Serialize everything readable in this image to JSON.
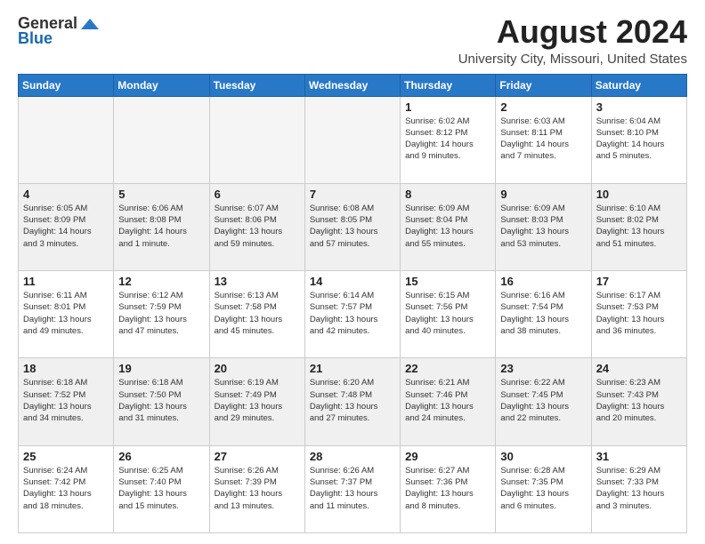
{
  "logo": {
    "general": "General",
    "blue": "Blue"
  },
  "title": {
    "month_year": "August 2024",
    "location": "University City, Missouri, United States"
  },
  "days_of_week": [
    "Sunday",
    "Monday",
    "Tuesday",
    "Wednesday",
    "Thursday",
    "Friday",
    "Saturday"
  ],
  "weeks": [
    {
      "shaded": false,
      "days": [
        {
          "date": "",
          "info": ""
        },
        {
          "date": "",
          "info": ""
        },
        {
          "date": "",
          "info": ""
        },
        {
          "date": "",
          "info": ""
        },
        {
          "date": "1",
          "info": "Sunrise: 6:02 AM\nSunset: 8:12 PM\nDaylight: 14 hours\nand 9 minutes."
        },
        {
          "date": "2",
          "info": "Sunrise: 6:03 AM\nSunset: 8:11 PM\nDaylight: 14 hours\nand 7 minutes."
        },
        {
          "date": "3",
          "info": "Sunrise: 6:04 AM\nSunset: 8:10 PM\nDaylight: 14 hours\nand 5 minutes."
        }
      ]
    },
    {
      "shaded": true,
      "days": [
        {
          "date": "4",
          "info": "Sunrise: 6:05 AM\nSunset: 8:09 PM\nDaylight: 14 hours\nand 3 minutes."
        },
        {
          "date": "5",
          "info": "Sunrise: 6:06 AM\nSunset: 8:08 PM\nDaylight: 14 hours\nand 1 minute."
        },
        {
          "date": "6",
          "info": "Sunrise: 6:07 AM\nSunset: 8:06 PM\nDaylight: 13 hours\nand 59 minutes."
        },
        {
          "date": "7",
          "info": "Sunrise: 6:08 AM\nSunset: 8:05 PM\nDaylight: 13 hours\nand 57 minutes."
        },
        {
          "date": "8",
          "info": "Sunrise: 6:09 AM\nSunset: 8:04 PM\nDaylight: 13 hours\nand 55 minutes."
        },
        {
          "date": "9",
          "info": "Sunrise: 6:09 AM\nSunset: 8:03 PM\nDaylight: 13 hours\nand 53 minutes."
        },
        {
          "date": "10",
          "info": "Sunrise: 6:10 AM\nSunset: 8:02 PM\nDaylight: 13 hours\nand 51 minutes."
        }
      ]
    },
    {
      "shaded": false,
      "days": [
        {
          "date": "11",
          "info": "Sunrise: 6:11 AM\nSunset: 8:01 PM\nDaylight: 13 hours\nand 49 minutes."
        },
        {
          "date": "12",
          "info": "Sunrise: 6:12 AM\nSunset: 7:59 PM\nDaylight: 13 hours\nand 47 minutes."
        },
        {
          "date": "13",
          "info": "Sunrise: 6:13 AM\nSunset: 7:58 PM\nDaylight: 13 hours\nand 45 minutes."
        },
        {
          "date": "14",
          "info": "Sunrise: 6:14 AM\nSunset: 7:57 PM\nDaylight: 13 hours\nand 42 minutes."
        },
        {
          "date": "15",
          "info": "Sunrise: 6:15 AM\nSunset: 7:56 PM\nDaylight: 13 hours\nand 40 minutes."
        },
        {
          "date": "16",
          "info": "Sunrise: 6:16 AM\nSunset: 7:54 PM\nDaylight: 13 hours\nand 38 minutes."
        },
        {
          "date": "17",
          "info": "Sunrise: 6:17 AM\nSunset: 7:53 PM\nDaylight: 13 hours\nand 36 minutes."
        }
      ]
    },
    {
      "shaded": true,
      "days": [
        {
          "date": "18",
          "info": "Sunrise: 6:18 AM\nSunset: 7:52 PM\nDaylight: 13 hours\nand 34 minutes."
        },
        {
          "date": "19",
          "info": "Sunrise: 6:18 AM\nSunset: 7:50 PM\nDaylight: 13 hours\nand 31 minutes."
        },
        {
          "date": "20",
          "info": "Sunrise: 6:19 AM\nSunset: 7:49 PM\nDaylight: 13 hours\nand 29 minutes."
        },
        {
          "date": "21",
          "info": "Sunrise: 6:20 AM\nSunset: 7:48 PM\nDaylight: 13 hours\nand 27 minutes."
        },
        {
          "date": "22",
          "info": "Sunrise: 6:21 AM\nSunset: 7:46 PM\nDaylight: 13 hours\nand 24 minutes."
        },
        {
          "date": "23",
          "info": "Sunrise: 6:22 AM\nSunset: 7:45 PM\nDaylight: 13 hours\nand 22 minutes."
        },
        {
          "date": "24",
          "info": "Sunrise: 6:23 AM\nSunset: 7:43 PM\nDaylight: 13 hours\nand 20 minutes."
        }
      ]
    },
    {
      "shaded": false,
      "days": [
        {
          "date": "25",
          "info": "Sunrise: 6:24 AM\nSunset: 7:42 PM\nDaylight: 13 hours\nand 18 minutes."
        },
        {
          "date": "26",
          "info": "Sunrise: 6:25 AM\nSunset: 7:40 PM\nDaylight: 13 hours\nand 15 minutes."
        },
        {
          "date": "27",
          "info": "Sunrise: 6:26 AM\nSunset: 7:39 PM\nDaylight: 13 hours\nand 13 minutes."
        },
        {
          "date": "28",
          "info": "Sunrise: 6:26 AM\nSunset: 7:37 PM\nDaylight: 13 hours\nand 11 minutes."
        },
        {
          "date": "29",
          "info": "Sunrise: 6:27 AM\nSunset: 7:36 PM\nDaylight: 13 hours\nand 8 minutes."
        },
        {
          "date": "30",
          "info": "Sunrise: 6:28 AM\nSunset: 7:35 PM\nDaylight: 13 hours\nand 6 minutes."
        },
        {
          "date": "31",
          "info": "Sunrise: 6:29 AM\nSunset: 7:33 PM\nDaylight: 13 hours\nand 3 minutes."
        }
      ]
    }
  ]
}
